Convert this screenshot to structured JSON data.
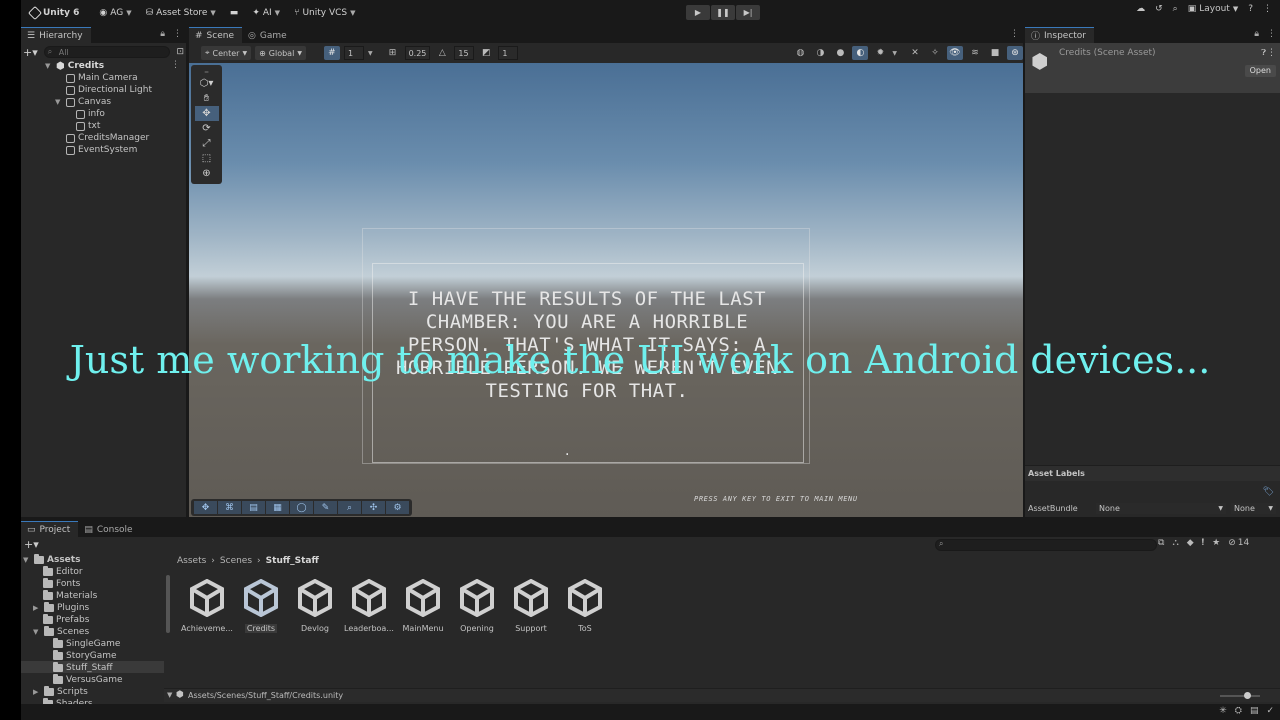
{
  "topbar": {
    "logo_label": "Unity 6",
    "account": "AG",
    "asset_store": "Asset Store",
    "ai": "AI",
    "vcs": "Unity VCS",
    "layout": "Layout"
  },
  "hierarchy": {
    "tab": "Hierarchy",
    "search_placeholder": "All",
    "scene_name": "Credits",
    "items": [
      "Main Camera",
      "Directional Light",
      "Canvas",
      "info",
      "txt",
      "CreditsManager",
      "EventSystem"
    ]
  },
  "scene": {
    "tab_scene": "Scene",
    "tab_game": "Game",
    "pivot": "Center",
    "space": "Global",
    "grid_value": "1",
    "snap_value": "0.25",
    "angle_value": "15",
    "scale_value": "1",
    "credits_text": "I HAVE THE RESULTS OF THE LAST CHAMBER: YOU ARE A HORRIBLE PERSON. THAT'S WHAT IT SAYS: A HORRIBLE PERSON. WE WEREN'T EVEN TESTING FOR THAT.",
    "credits_lines": [
      "I HAVE THE RESULTS OF THE LAST",
      "CHAMBER: YOU ARE A HORRIBLE",
      "PERSON. THAT'S WHAT IT SAYS: A",
      "HORRIBLE PERSON. WE WEREN'T EVEN",
      "TESTING FOR THAT."
    ],
    "dot": ".",
    "press_any_key": "PRESS ANY KEY TO EXIT TO MAIN MENU"
  },
  "inspector": {
    "tab": "Inspector",
    "title": "Credits (Scene Asset)",
    "open_button": "Open",
    "asset_labels": "Asset Labels",
    "asset_bundle_label": "AssetBundle",
    "asset_bundle_value": "None",
    "asset_variant_value": "None"
  },
  "caption": "Just me working to make the UI work on Android devices...",
  "project": {
    "tab_project": "Project",
    "tab_console": "Console",
    "tree": [
      {
        "label": "Assets",
        "level": 0,
        "bold": true
      },
      {
        "label": "Editor",
        "level": 1
      },
      {
        "label": "Fonts",
        "level": 1
      },
      {
        "label": "Materials",
        "level": 1
      },
      {
        "label": "Plugins",
        "level": 1
      },
      {
        "label": "Prefabs",
        "level": 1
      },
      {
        "label": "Scenes",
        "level": 1
      },
      {
        "label": "SingleGame",
        "level": 2
      },
      {
        "label": "StoryGame",
        "level": 2
      },
      {
        "label": "Stuff_Staff",
        "level": 2,
        "selected": true
      },
      {
        "label": "VersusGame",
        "level": 2
      },
      {
        "label": "Scripts",
        "level": 1
      },
      {
        "label": "Shaders",
        "level": 1
      }
    ],
    "breadcrumb": [
      "Assets",
      "Scenes",
      "Stuff_Staff"
    ],
    "hidden_count": "14",
    "assets": [
      "Achieveme...",
      "Credits",
      "Devlog",
      "Leaderboa...",
      "MainMenu",
      "Opening",
      "Support",
      "ToS"
    ],
    "selected_asset": "Credits",
    "path": "Assets/Scenes/Stuff_Staff/Credits.unity"
  }
}
